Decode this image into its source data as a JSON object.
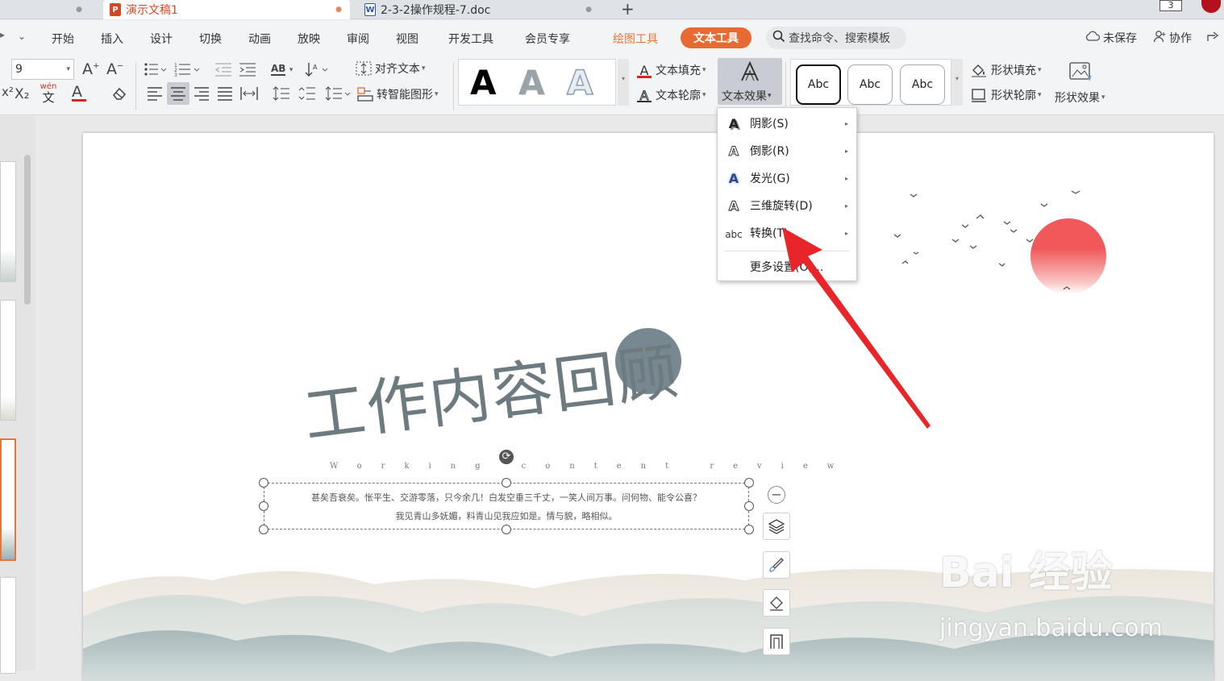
{
  "tabs": {
    "ppt_title": "演示文稿1",
    "doc_title": "2-3-2操作规程-7.doc",
    "new_tab": "+",
    "window_count": "3",
    "ppt_icon": "P",
    "doc_icon": "W"
  },
  "menu": {
    "items": [
      "开始",
      "插入",
      "设计",
      "切换",
      "动画",
      "放映",
      "审阅",
      "视图",
      "开发工具",
      "会员专享"
    ],
    "drawing_tools": "绘图工具",
    "text_tools": "文本工具",
    "search_placeholder": "查找命令、搜索模板",
    "unsaved": "未保存",
    "collaborate": "协作"
  },
  "ribbon": {
    "font_size": "9",
    "align_text": "对齐文本",
    "smart_shape": "转智能图形",
    "text_fill": "文本填充",
    "text_outline": "文本轮廓",
    "text_effect": "文本效果",
    "wordart_glyph": "A",
    "style_sample": "Abc",
    "shape_fill": "形状填充",
    "shape_outline": "形状轮廓",
    "shape_effect": "形状效果",
    "ab_label": "AB",
    "wen_label": "wén",
    "wen_char": "文"
  },
  "dropdown": {
    "items": [
      {
        "label": "阴影(S)",
        "icon": "shadow-a-icon",
        "glyph": "A"
      },
      {
        "label": "倒影(R)",
        "icon": "reflection-a-icon",
        "glyph": "A"
      },
      {
        "label": "发光(G)",
        "icon": "glow-a-icon",
        "glyph": "A"
      },
      {
        "label": "三维旋转(D)",
        "icon": "3d-rotation-a-icon",
        "glyph": "A"
      },
      {
        "label": "转换(T)",
        "icon": "transform-abc-icon",
        "glyph": "abc"
      }
    ],
    "more": "更多设置(O)..."
  },
  "slide": {
    "title": "工作内容回顾",
    "subtitle": "Working content review",
    "body_line1": "甚矣吾衰矣。怅平生、交游零落，只今余几！白发空垂三千丈，一笑人间万事。问何物、能令公喜？",
    "body_line2": "我见青山多妩媚，料青山见我应如是。情与貌，略相似。"
  },
  "watermark": {
    "brand": "Bai  经验",
    "url": "jingyan.baidu.com"
  },
  "colors": {
    "accent": "#e86a33",
    "arrow": "#e8262a",
    "sun": "#f0585a",
    "title_text": "#6d7b80"
  }
}
